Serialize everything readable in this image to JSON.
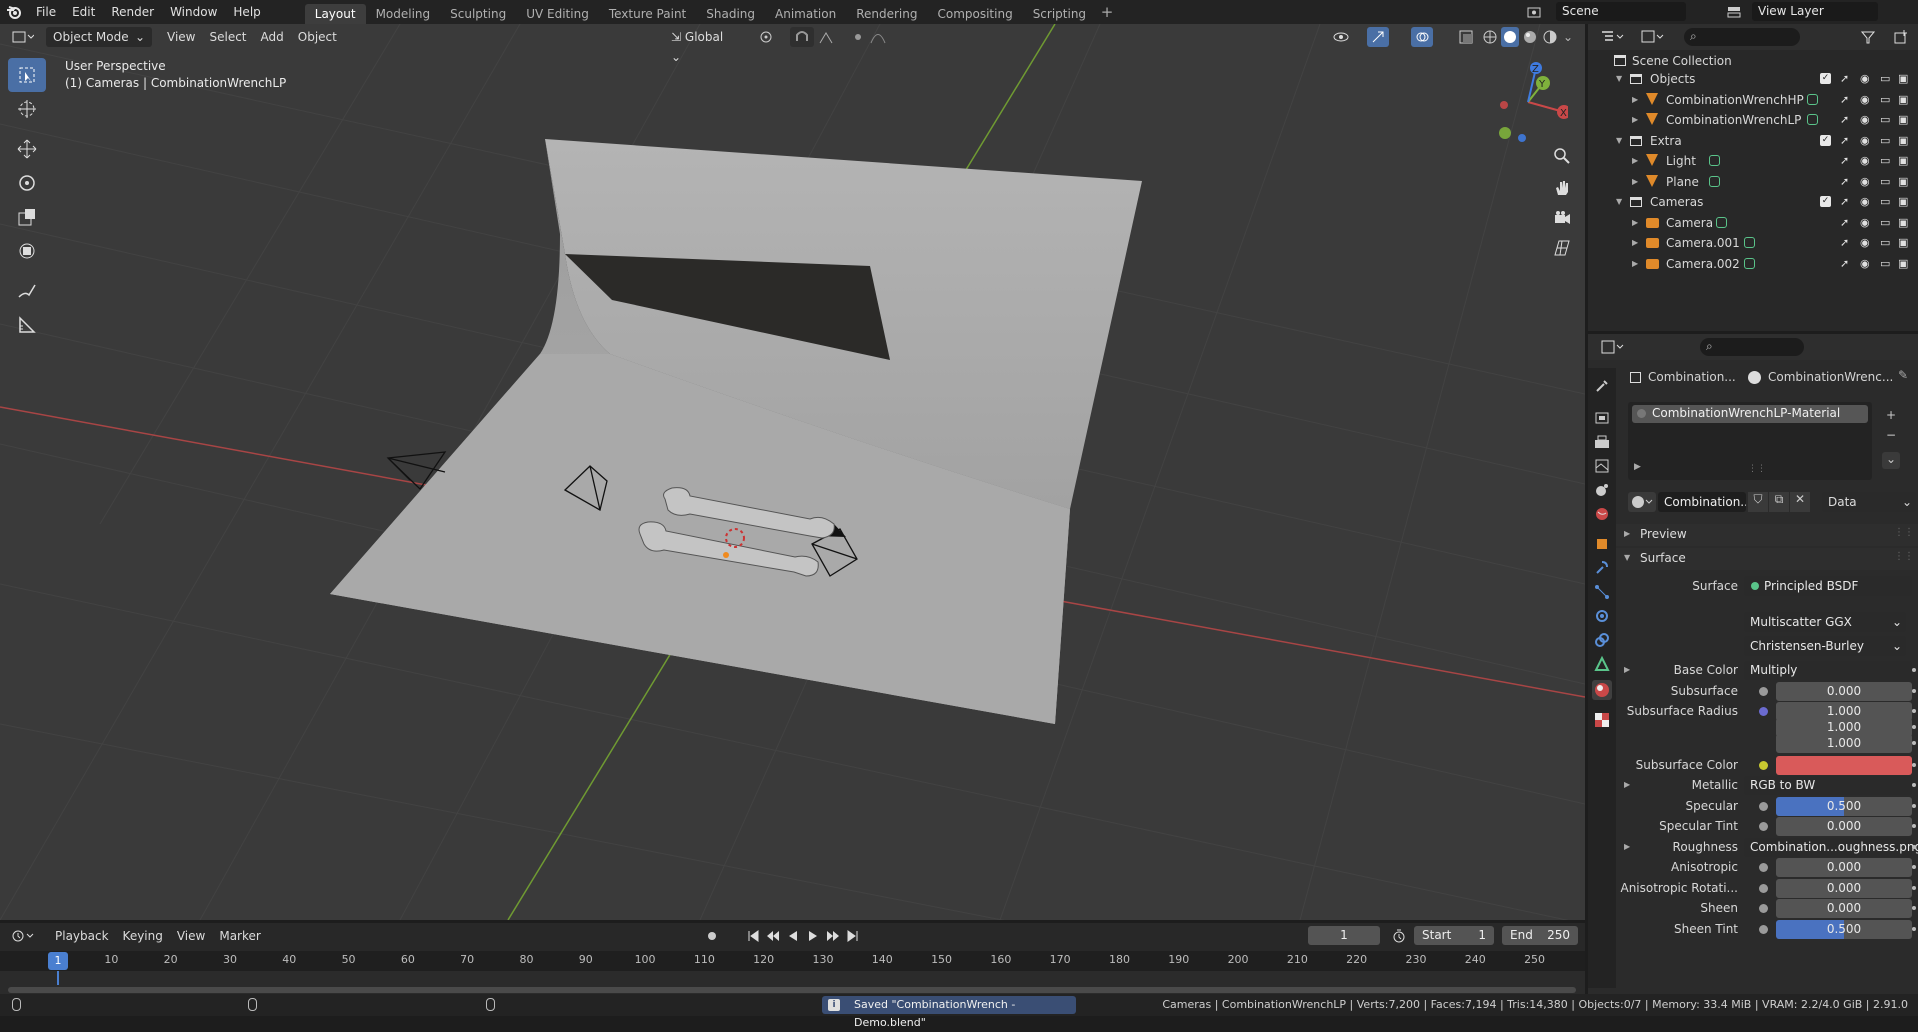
{
  "topbar": {
    "menus": [
      "File",
      "Edit",
      "Render",
      "Window",
      "Help"
    ],
    "workspaces": [
      "Layout",
      "Modeling",
      "Sculpting",
      "UV Editing",
      "Texture Paint",
      "Shading",
      "Animation",
      "Rendering",
      "Compositing",
      "Scripting"
    ],
    "active_workspace": "Layout",
    "scene": "Scene",
    "view_layer": "View Layer"
  },
  "viewport": {
    "mode": "Object Mode",
    "menus": [
      "View",
      "Select",
      "Add",
      "Object"
    ],
    "orientation": "Global",
    "info_line1": "User Perspective",
    "info_line2": "(1) Cameras | CombinationWrenchLP",
    "gizmo": {
      "x": "X",
      "y": "Y",
      "z": "Z"
    }
  },
  "outliner": {
    "root": "Scene Collection",
    "rows": [
      {
        "label": "Objects",
        "type": "collection",
        "indent": 1
      },
      {
        "label": "CombinationWrenchHP",
        "type": "mesh",
        "indent": 2
      },
      {
        "label": "CombinationWrenchLP",
        "type": "mesh",
        "indent": 2
      },
      {
        "label": "Extra",
        "type": "collection",
        "indent": 1
      },
      {
        "label": "Light",
        "type": "mesh",
        "indent": 2
      },
      {
        "label": "Plane",
        "type": "mesh",
        "indent": 2
      },
      {
        "label": "Cameras",
        "type": "collection",
        "indent": 1
      },
      {
        "label": "Camera",
        "type": "camera",
        "indent": 2
      },
      {
        "label": "Camera.001",
        "type": "camera",
        "indent": 2
      },
      {
        "label": "Camera.002",
        "type": "camera",
        "indent": 2
      }
    ]
  },
  "properties": {
    "breadcrumb_object": "Combination...",
    "breadcrumb_material": "CombinationWrenc...",
    "material_slot": "CombinationWrenchLP-Material",
    "material_name": "Combination...",
    "link_mode": "Data",
    "preview_label": "Preview",
    "surface_label": "Surface",
    "surface_shader": "Principled BSDF",
    "distribution": "Multiscatter GGX",
    "subsurface_method": "Christensen-Burley",
    "rows": [
      {
        "label": "Base Color",
        "value": "Multiply",
        "kind": "link",
        "dot": "#c8c830",
        "expand": true
      },
      {
        "label": "Subsurface",
        "value": "0.000",
        "kind": "num",
        "dot": "#9a9a9a"
      },
      {
        "label": "Subsurface Radius",
        "value": "1.000",
        "kind": "num",
        "dot": "#6b6bd0"
      },
      {
        "label": "",
        "value": "1.000",
        "kind": "num"
      },
      {
        "label": "",
        "value": "1.000",
        "kind": "num"
      },
      {
        "label": "Subsurface Color",
        "value": "",
        "kind": "color",
        "dot": "#c8c830",
        "color": "#d95a5a"
      },
      {
        "label": "Metallic",
        "value": "RGB to BW",
        "kind": "link",
        "dot": "#9a9a9a",
        "expand": true
      },
      {
        "label": "Specular",
        "value": "0.500",
        "kind": "slider",
        "dot": "#9a9a9a",
        "fill": 0.5
      },
      {
        "label": "Specular Tint",
        "value": "0.000",
        "kind": "num",
        "dot": "#9a9a9a"
      },
      {
        "label": "Roughness",
        "value": "Combination...oughness.png",
        "kind": "link",
        "dot": "#c8c830",
        "expand": true
      },
      {
        "label": "Anisotropic",
        "value": "0.000",
        "kind": "num",
        "dot": "#9a9a9a"
      },
      {
        "label": "Anisotropic Rotati...",
        "value": "0.000",
        "kind": "num",
        "dot": "#9a9a9a"
      },
      {
        "label": "Sheen",
        "value": "0.000",
        "kind": "num",
        "dot": "#9a9a9a"
      },
      {
        "label": "Sheen Tint",
        "value": "0.500",
        "kind": "slider",
        "dot": "#9a9a9a",
        "fill": 0.5
      }
    ]
  },
  "timeline": {
    "menus": [
      "Playback",
      "Keying",
      "View",
      "Marker"
    ],
    "current_frame": "1",
    "start_label": "Start",
    "start": "1",
    "end_label": "End",
    "end": "250",
    "ticks": [
      "1",
      "10",
      "20",
      "30",
      "40",
      "50",
      "60",
      "70",
      "80",
      "90",
      "100",
      "110",
      "120",
      "130",
      "140",
      "150",
      "160",
      "170",
      "180",
      "190",
      "200",
      "210",
      "220",
      "230",
      "240",
      "250"
    ]
  },
  "status": {
    "message": "Saved \"CombinationWrench - Demo.blend\"",
    "stats": "Cameras | CombinationWrenchLP | Verts:7,200 | Faces:7,194 | Tris:14,380 | Objects:0/7 | Memory: 33.4 MiB | VRAM: 2.2/4.0 GiB | 2.91.0"
  },
  "colors": {
    "accent": "#4a6fa5",
    "x_axis": "#c94848",
    "y_axis": "#7fb13c",
    "z_axis": "#3f7be0"
  }
}
